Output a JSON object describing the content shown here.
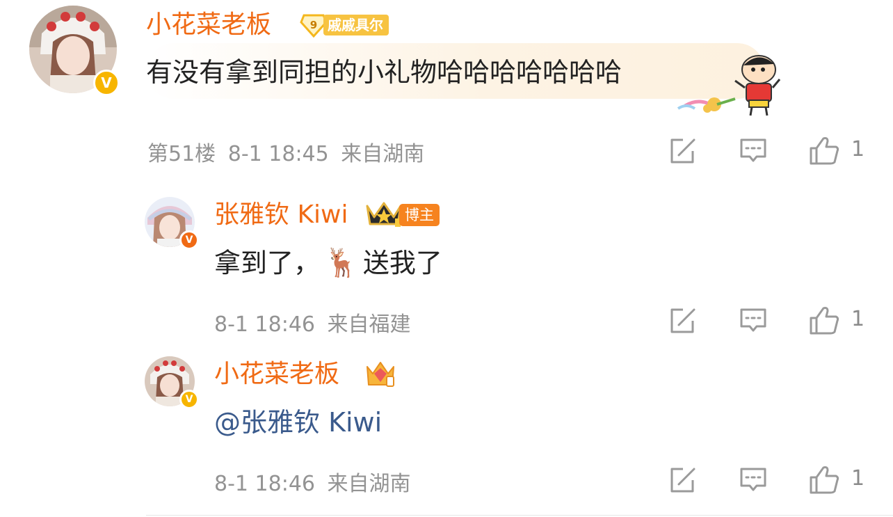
{
  "comments": [
    {
      "username": "小花菜老板",
      "fan_badge_level": "9",
      "fan_badge_label": "戚戚具尔",
      "text": "有没有拿到同担的小礼物哈哈哈哈哈哈哈",
      "floor": "第51楼",
      "time": "8-1 18:45",
      "location": "来自湖南",
      "likes": "1"
    },
    {
      "username": "张雅钦 Kiwi",
      "host_badge": "博主",
      "text_before": "拿到了，",
      "emoji": "🦌",
      "text_after": "送我了",
      "time": "8-1 18:46",
      "location": "来自福建",
      "likes": "1"
    },
    {
      "username": "小花菜老板",
      "mention": "@张雅钦 Kiwi",
      "time": "8-1 18:46",
      "location": "来自湖南",
      "likes": "1"
    }
  ],
  "colors": {
    "username": "#f06a14",
    "meta": "#939393",
    "mention": "#3a5a8c",
    "verified": "#f7b500"
  },
  "icons": [
    "share-icon",
    "comment-icon",
    "like-icon",
    "verified-icon",
    "crown-icon",
    "fan-badge-icon"
  ]
}
